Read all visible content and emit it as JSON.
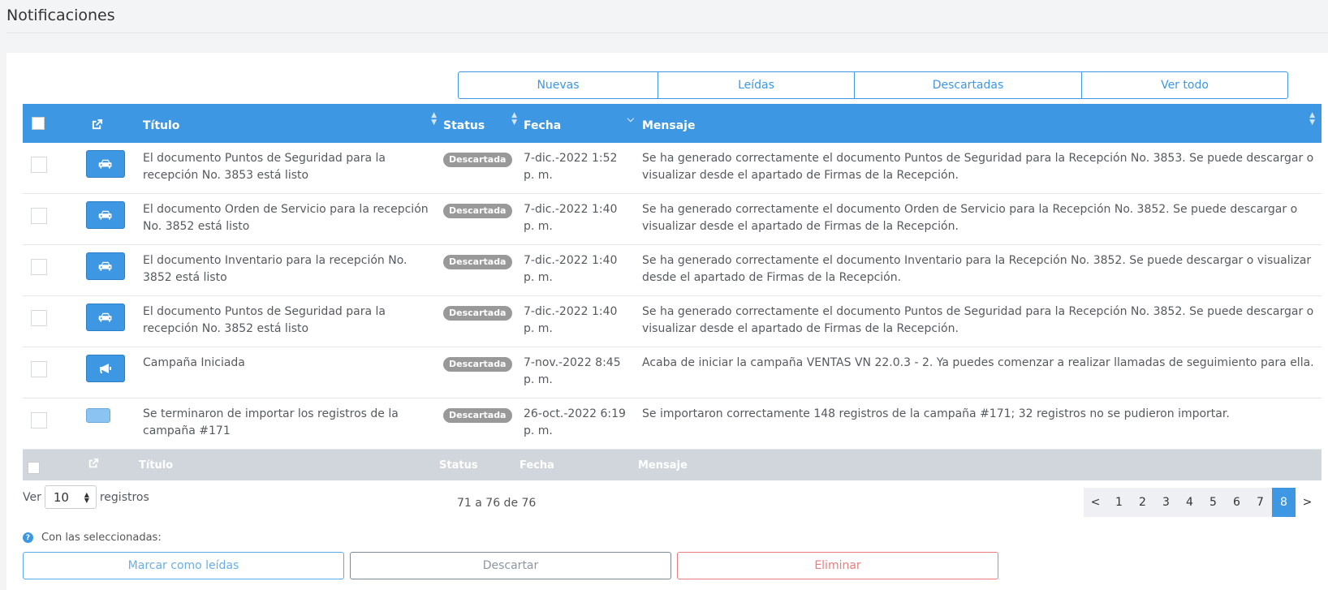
{
  "page": {
    "title": "Notificaciones"
  },
  "filters": [
    "Nuevas",
    "Leídas",
    "Descartadas",
    "Ver todo"
  ],
  "table": {
    "headers": {
      "title": "Título",
      "status": "Status",
      "date": "Fecha",
      "message": "Mensaje"
    },
    "rows": [
      {
        "icon": "car-icon",
        "title": "El documento Puntos de Seguridad para la recepción No. 3853 está listo",
        "status": "Descartada",
        "date": "7-dic.-2022 1:52 p. m.",
        "message": "Se ha generado correctamente el documento Puntos de Seguridad para la Recepción No. 3853. Se puede descargar o visualizar desde el apartado de Firmas de la Recepción."
      },
      {
        "icon": "car-icon",
        "title": "El documento Orden de Servicio para la recepción No. 3852 está listo",
        "status": "Descartada",
        "date": "7-dic.-2022 1:40 p. m.",
        "message": "Se ha generado correctamente el documento Orden de Servicio para la Recepción No. 3852. Se puede descargar o visualizar desde el apartado de Firmas de la Recepción."
      },
      {
        "icon": "car-icon",
        "title": "El documento Inventario para la recepción No. 3852 está listo",
        "status": "Descartada",
        "date": "7-dic.-2022 1:40 p. m.",
        "message": "Se ha generado correctamente el documento Inventario para la Recepción No. 3852. Se puede descargar o visualizar desde el apartado de Firmas de la Recepción."
      },
      {
        "icon": "car-icon",
        "title": "El documento Puntos de Seguridad para la recepción No. 3852 está listo",
        "status": "Descartada",
        "date": "7-dic.-2022 1:40 p. m.",
        "message": "Se ha generado correctamente el documento Puntos de Seguridad para la Recepción No. 3852. Se puede descargar o visualizar desde el apartado de Firmas de la Recepción."
      },
      {
        "icon": "megaphone-icon",
        "title": "Campaña Iniciada",
        "status": "Descartada",
        "date": "7-nov.-2022 8:45 p. m.",
        "message": "Acaba de iniciar la campaña VENTAS VN 22.0.3 - 2. Ya puedes comenzar a realizar llamadas de seguimiento para ella."
      },
      {
        "icon": "blank-icon",
        "title": "Se terminaron de importar los registros de la campaña #171",
        "status": "Descartada",
        "date": "26-oct.-2022 6:19 p. m.",
        "message": "Se importaron correctamente 148 registros de la campaña #171; 32 registros no se pudieron importar."
      }
    ]
  },
  "length": {
    "prefix": "Ver",
    "value": "10",
    "suffix": "registros"
  },
  "info": "71 a 76 de 76",
  "pagination": {
    "prev": "<",
    "pages": [
      "1",
      "2",
      "3",
      "4",
      "5",
      "6",
      "7",
      "8"
    ],
    "active": "8",
    "next": ">"
  },
  "bulk": {
    "label": "Con las seleccionadas:",
    "mark_read": "Marcar como leídas",
    "discard": "Descartar",
    "delete": "Eliminar"
  },
  "colors": {
    "primary": "#3d97e2",
    "badge": "#999999",
    "danger": "#ea7c7c"
  }
}
